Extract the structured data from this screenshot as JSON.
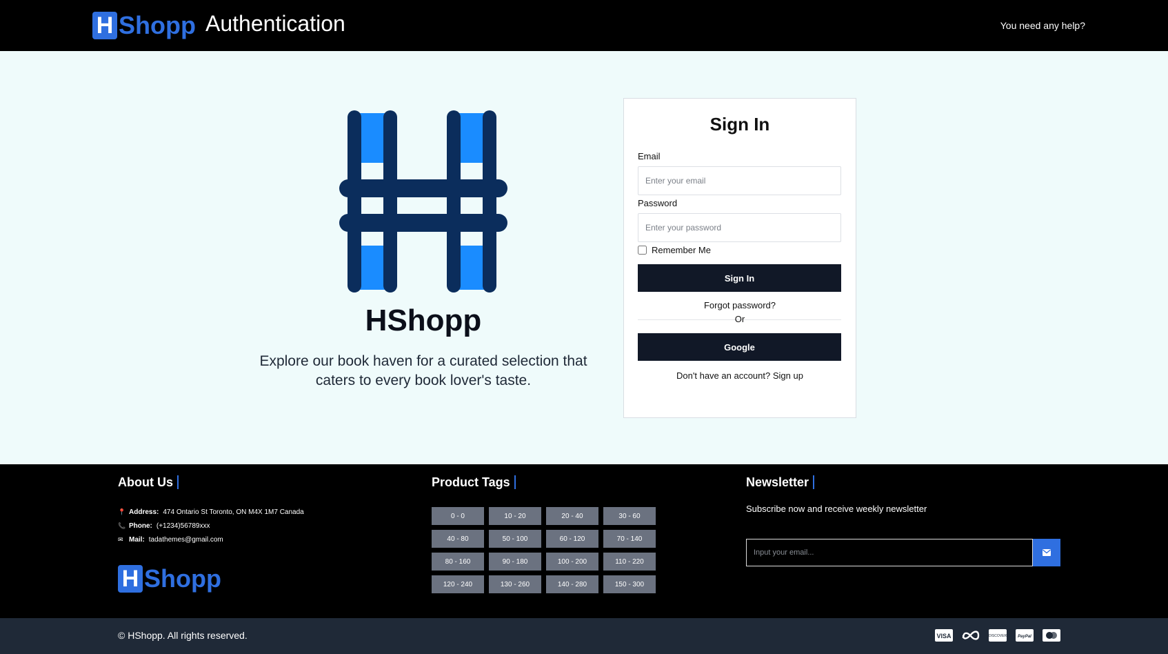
{
  "header": {
    "logo_letter": "H",
    "logo_text": "Shopp",
    "title": "Authentication",
    "help_link": "You need any help?"
  },
  "brand": {
    "name": "HShopp",
    "description": "Explore our book haven for a curated selection that caters to every book lover's taste."
  },
  "signin": {
    "title": "Sign In",
    "email_label": "Email",
    "email_placeholder": "Enter your email",
    "password_label": "Password",
    "password_placeholder": "Enter your password",
    "remember_label": "Remember Me",
    "remember_checked": false,
    "submit_label": "Sign In",
    "forgot_label": "Forgot password?",
    "or_label": "Or",
    "google_label": "Google",
    "signup_text": "Don't have an account? Sign up"
  },
  "footer": {
    "about": {
      "heading": "About Us",
      "address_label": "Address:",
      "address": "474 Ontario St Toronto, ON M4X 1M7 Canada",
      "phone_label": "Phone:",
      "phone": "(+1234)56789xxx",
      "mail_label": "Mail:",
      "mail": "tadathemes@gmail.com"
    },
    "tags": {
      "heading": "Product Tags",
      "items": [
        "0 - 0",
        "10 - 20",
        "20 - 40",
        "30 - 60",
        "40 - 80",
        "50 - 100",
        "60 - 120",
        "70 - 140",
        "80 - 160",
        "90 - 180",
        "100 - 200",
        "110 - 220",
        "120 - 240",
        "130 - 260",
        "140 - 280",
        "150 - 300"
      ]
    },
    "newsletter": {
      "heading": "Newsletter",
      "subtitle": "Subscribe now and receive weekly newsletter",
      "placeholder": "Input your email...",
      "submit_icon": "envelope-icon"
    },
    "copyright": "© HShopp. All rights reserved.",
    "payments": [
      "visa-icon",
      "meta-icon",
      "discover-icon",
      "paypal-icon",
      "mastercard-icon"
    ]
  },
  "colors": {
    "accent": "#2f6fe0",
    "dark_button": "#111827",
    "page_bg": "#effbfb",
    "brand_navy": "#0b2d5c",
    "brand_blue": "#1a8cff"
  }
}
